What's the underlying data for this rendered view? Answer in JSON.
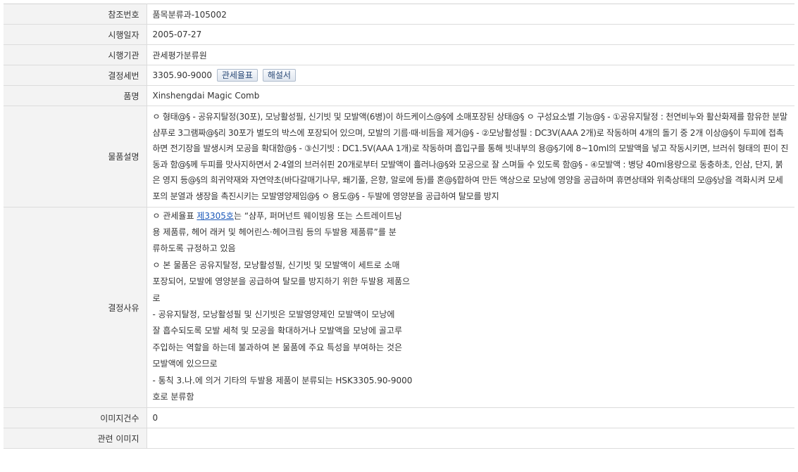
{
  "labels": {
    "ref_no": "참조번호",
    "date": "시행일자",
    "agency": "시행기관",
    "hs": "결정세번",
    "item_name": "품명",
    "description": "물품설명",
    "reason": "결정사유",
    "image_count": "이미지건수",
    "related_images": "관련 이미지"
  },
  "values": {
    "ref_no": "품목분류과-105002",
    "date": "2005-07-27",
    "agency": "관세평가분류원",
    "hs_code": "3305.90-9000",
    "tariff_button": "관세율표",
    "explanatory_button": "해설서",
    "item_name": "Xinshengdai Magic Comb",
    "description": "ㅇ 형태@§ - 공유지탈정(30포), 모낭활성필, 신기빗 및 모발액(6병)이 하드케이스@§에 소매포장된 상태@§ ㅇ 구성요소별 기능@§ - ①공유지탈정 : 천연비누와 활산화제를 함유한 분말 샴푸로 3그램짜@§리 30포가 별도의 박스에 포장되어 있으며, 모발의 기름·때·비듬을 제거@§ - ②모낭활성필 : DC3V(AAA 2개)로 작동하며 4개의 돌기 중 2개 이상@§이 두피에 접촉하면 전기장을 발생시켜 모공을 확대함@§ - ③신기빗 : DC1.5V(AAA 1개)로 작동하며 흡입구를 통해 빗내부의 용@§기에 8~10ml의 모발액을 넣고 작동시키면, 브러쉬 형태의 핀이 진동과 함@§께 두피를 맛사지하면서 2·4열의 브러쉬핀 20개로부터 모발액이 흘러나@§와 모공으로 잘 스며들 수 있도록 함@§ - ④모발액 : 병당 40ml용량으로 동충하초, 인삼, 단지, 붉은 영지 등@§의 희귀약재와 자연약초(바다갈매기나무, 쐐기풀, 은향, 알로에 등)를 혼@§합하여 만든 액상으로 모낭에 영양을 공급하며 휴면상태와 위축상태의 모@§낭을 격화시켜 모세포의 분열과 생장을 촉진시키는 모발영양제임@§ ㅇ 용도@§ - 두발에 영양분을 공급하여 탈모를 방지",
    "reason": {
      "l1_pre": "ㅇ 관세율표 ",
      "l1_link": "제3305호",
      "l1_post": "는 “샴푸, 퍼머넌트 웨이빙용 또는 스트레이트닝",
      "l2": "용 제품류, 헤어 래커 및 헤어린스·헤어크림 등의 두발용 제품류”를 분",
      "l3": "류하도록 규정하고 있음",
      "l4": "ㅇ 본 물품은 공유지탈정, 모낭활성필, 신기빗 및 모발액이 세트로 소매",
      "l5": "포장되어, 모발에 영양분을 공급하여 탈모를 방지하기 위한 두발용 제품으",
      "l6": "로",
      "l7": "- 공유지탈정, 모낭활성필 및 신기빗은 모발영양제인 모발액이 모낭에",
      "l8": "잘 흡수되도록 모발 세척 및 모공을 확대하거나 모발액을 모낭에 골고루",
      "l9": "주입하는 역할을 하는데 불과하여 본 물품에 주요 특성을 부여하는 것은",
      "l10": "모발액에 있으므로",
      "l11": "- 통칙 3.나.에 의거 기타의 두발용 제품이 분류되는 HSK3305.90-9000",
      "l12": "호로 분류함"
    },
    "image_count": "0",
    "related_images": ""
  }
}
